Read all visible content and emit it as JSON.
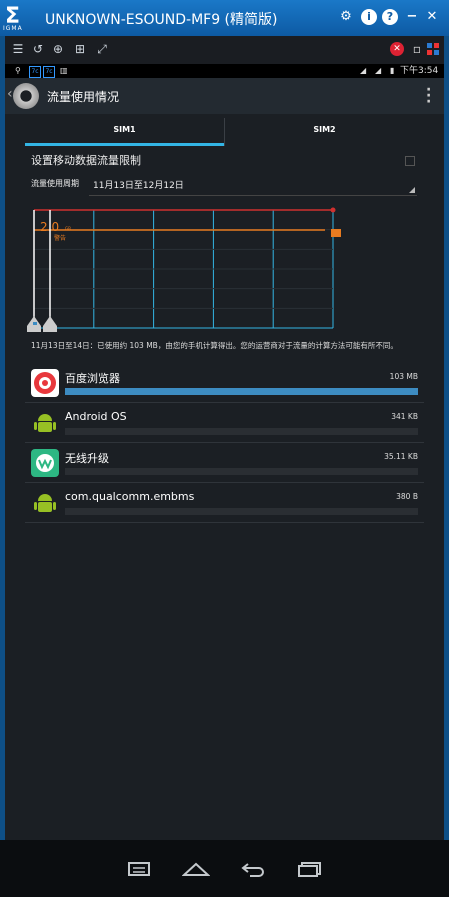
{
  "window": {
    "logo_letter": "Σ",
    "logo_sub": "IGMA",
    "title": "UNKNOWN-ESOUND-MF9 (精简版)",
    "controls": [
      {
        "name": "settings-icon",
        "glyph": "⚙"
      },
      {
        "name": "info-icon",
        "glyph": "i"
      },
      {
        "name": "help-icon",
        "glyph": "?"
      },
      {
        "name": "minimize-icon",
        "glyph": "−"
      },
      {
        "name": "close-icon",
        "glyph": "✕"
      }
    ]
  },
  "toolbar": {
    "left_icons": [
      "list-icon",
      "rotate-icon",
      "zoom-icon",
      "screenshot-icon",
      "fullscreen-icon"
    ],
    "right_icons": [
      "mute-icon",
      "window-icon",
      "grid-icon"
    ]
  },
  "statusbar": {
    "time": "下午3:54"
  },
  "actionbar": {
    "title": "流量使用情况"
  },
  "tabs": [
    {
      "label": "SIM1",
      "active": true
    },
    {
      "label": "SIM2",
      "active": false
    }
  ],
  "settings": {
    "limit_label": "设置移动数据流量限制",
    "cycle_label": "流量使用周期",
    "cycle_value": "11月13日至12月12日"
  },
  "chart_data": {
    "type": "line",
    "warning_value": "2.0",
    "warning_unit": "GB",
    "warning_label": "警告",
    "colors": {
      "limit": "#d0302f",
      "warning": "#e87b20",
      "grid": "#33b5e5"
    }
  },
  "caption": "11月13日至14日：已使用约 103 MB，由您的手机计算得出。您的运营商对于流量的计算方法可能有所不同。",
  "apps": [
    {
      "name": "百度浏览器",
      "size": "103 MB",
      "fraction": 1.0,
      "icon": "baidu-browser-icon",
      "color": "#e8383d"
    },
    {
      "name": "Android OS",
      "size": "341 KB",
      "fraction": 0.0,
      "icon": "android-icon",
      "color": "#97c024"
    },
    {
      "name": "无线升级",
      "size": "35.11 KB",
      "fraction": 0.0,
      "icon": "wireless-update-icon",
      "color": "#2db783"
    },
    {
      "name": "com.qualcomm.embms",
      "size": "380 B",
      "fraction": 0.0,
      "icon": "android-icon",
      "color": "#97c024"
    }
  ],
  "navbar": [
    "recent-apps-icon",
    "home-icon",
    "back-icon",
    "multi-window-icon"
  ]
}
